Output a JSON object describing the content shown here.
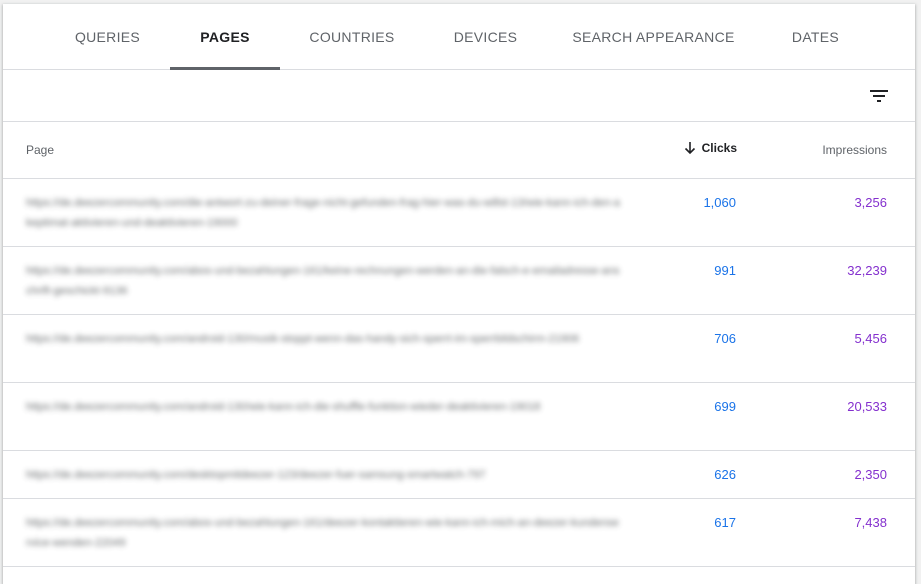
{
  "tabs": [
    {
      "label": "QUERIES"
    },
    {
      "label": "PAGES",
      "active": true
    },
    {
      "label": "COUNTRIES"
    },
    {
      "label": "DEVICES"
    },
    {
      "label": "SEARCH APPEARANCE"
    },
    {
      "label": "DATES"
    }
  ],
  "toolbar": {
    "filter_icon": "filter-list-icon"
  },
  "table": {
    "headers": {
      "page": "Page",
      "clicks": "Clicks",
      "impressions": "Impressions"
    },
    "rows": [
      {
        "url": "https://de.deezercommunity.com/die-antwort-zu-deiner-frage-nicht-gefunden-frag-hier-was-du-willst-13/wie-kann-ich-den-akeptimat-aktivieren-und-deaktivieren-19000",
        "clicks": "1,060",
        "impressions": "3,256"
      },
      {
        "url": "https://de.deezercommunity.com/abos-und-bezahlungen-161/keine-rechnungen-werden-an-die-falsch-e-emailadresse-anschrift-geschickt-9136",
        "clicks": "991",
        "impressions": "32,239"
      },
      {
        "url": "https://de.deezercommunity.com/android-130/musik-stoppt-wenn-das-handy-sich-sperrt-im-sperrbildschirm-21906",
        "clicks": "706",
        "impressions": "5,456"
      },
      {
        "url": "https://de.deezercommunity.com/android-130/wie-kann-ich-die-shuffle-funktion-wieder-deaktivieren-19018",
        "clicks": "699",
        "impressions": "20,533"
      },
      {
        "url": "https://de.deezercommunity.com/desktopmitdeezer-123/deezer-fuer-samsung-smartwatch-797",
        "clicks": "626",
        "impressions": "2,350"
      },
      {
        "url": "https://de.deezercommunity.com/abos-und-bezahlungen-161/deezer-kontaktieren-wie-kann-ich-mich-an-deezer-kundenservice-wenden-22049",
        "clicks": "617",
        "impressions": "7,438"
      }
    ]
  }
}
